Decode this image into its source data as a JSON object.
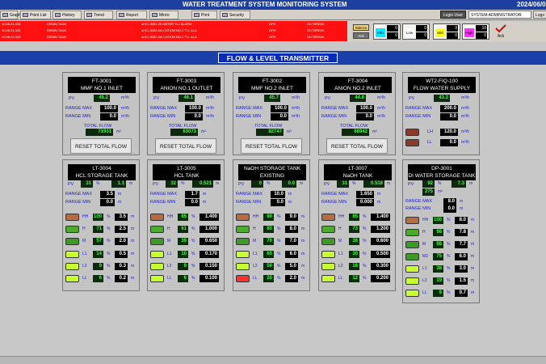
{
  "title": "WATER TREATMENT SYSTEM   MONITORING SYSTEM",
  "date": "2024/06/0",
  "toolbar": {
    "buttons": [
      {
        "label": "Graphics",
        "icon": "graphics-icon"
      },
      {
        "label": "Point List",
        "icon": "list-icon"
      },
      {
        "label": "History",
        "icon": "history-icon"
      },
      {
        "label": "Trend",
        "icon": "trend-icon"
      },
      {
        "label": "Report",
        "icon": "report-icon"
      },
      {
        "label": "Mimic",
        "icon": "mimic-icon"
      },
      {
        "label": "Print",
        "icon": "print-icon"
      },
      {
        "label": "Security",
        "icon": "security-icon"
      }
    ],
    "login_label": "Login User",
    "user": "SYSTEM ADMINISTRATOR",
    "logout_label": "Logo"
  },
  "alarms": [
    {
      "time": "10:06:21:333",
      "area": "DEMIN TANK",
      "desc": "aHIC-3003 26 WATER TLL ALARM",
      "state": "OFH",
      "status": "OUTBREAK"
    },
    {
      "time": "10:06:21:333",
      "area": "DEMIN TANK",
      "desc": "aHIC-3003 ##I CATION NO.1 TLL ALA",
      "state": "OFH",
      "status": "OUTBREAK"
    },
    {
      "time": "10:06:21:333",
      "area": "DEMIN TANK",
      "desc": "aHIC-3003 ##I CATION NO.1 TLL ALA",
      "state": "OFH",
      "status": "OUTBREAK"
    }
  ],
  "alarm_controls": {
    "silence": "Silence",
    "ack": "Ack"
  },
  "counters": [
    {
      "label": "Info",
      "v1": "0",
      "v2": "0",
      "color": "#00e8ff"
    },
    {
      "label": "Low",
      "v1": "0",
      "v2": "0",
      "color": "#ffffff"
    },
    {
      "label": "Mid",
      "v1": "3",
      "v2": "0",
      "color": "#ffff20"
    },
    {
      "label": "High",
      "v1": "10",
      "v2": "0",
      "color": "#ff30ff"
    }
  ],
  "ack_all_label": "Ack",
  "page_title": "FLOW & LEVEL TRANSMITTER",
  "flow_cards": [
    {
      "tag": "FT-3001",
      "name": "MMF NO.1  INLET",
      "pv": "45.2",
      "range_max": "100.0",
      "range_min": "0.0",
      "total": "71931"
    },
    {
      "tag": "FT-3003",
      "name": "ANION  NO.1 OUTLET",
      "pv": "46.1",
      "range_max": "100.0",
      "range_min": "0.0",
      "total": "63073"
    },
    {
      "tag": "FT-3002",
      "name": "MMF NO.2  INLET",
      "pv": "45.7",
      "range_max": "100.0",
      "range_min": "0.0",
      "total": "82747"
    },
    {
      "tag": "FT-3004",
      "name": "ANION  NO.2  INLET",
      "pv": "44.8",
      "range_max": "100.0",
      "range_min": "0.0",
      "total": "68942"
    }
  ],
  "wt2": {
    "tag": "WT2-FIQ-100",
    "name": "FLOW WATER SUPPLY",
    "pv": "43.2",
    "range_max": "200.0",
    "range_min": "0.0",
    "lh": "120.0",
    "ll": "0.0"
  },
  "labels": {
    "pv": "PV",
    "range_max": "RANGE MAX",
    "range_min": "RANGE MIN",
    "total_flow": "TOTAL FLOW",
    "reset": "RESET TOTAL FLOW",
    "flow_unit": "m³/h",
    "vol_unit": "m³",
    "pct": "%",
    "m": "m",
    "lh": "LH",
    "ll": "LL"
  },
  "level_cards": [
    {
      "tag": "LT-3004",
      "name": "HCL STORAGE TANK",
      "pv_pct": "31",
      "pv_m": "1.1",
      "range_max": "3.5",
      "range_min": "0.0",
      "alarms": [
        {
          "l": "HH",
          "p": "100",
          "v": "3.5"
        },
        {
          "l": "H",
          "p": "71",
          "v": "2.5"
        },
        {
          "l": "M",
          "p": "57",
          "v": "2.0"
        },
        {
          "l": "L1",
          "p": "14",
          "v": "0.5"
        },
        {
          "l": "L2",
          "p": "9",
          "v": "0.3"
        },
        {
          "l": "LL",
          "p": "6",
          "v": "0.2"
        }
      ]
    },
    {
      "tag": "LT-3005",
      "name": "HCL TANK",
      "pv_pct": "32",
      "pv_m": "0.521",
      "range_max": "1.7",
      "range_min": "0.0",
      "alarms": [
        {
          "l": "HH",
          "p": "85",
          "v": "1.400"
        },
        {
          "l": "H",
          "p": "61",
          "v": "1.000"
        },
        {
          "l": "M",
          "p": "39",
          "v": "0.650"
        },
        {
          "l": "L1",
          "p": "10",
          "v": "0.170"
        },
        {
          "l": "L2",
          "p": "9",
          "v": "0.150"
        },
        {
          "l": "LL",
          "p": "6",
          "v": "0.100"
        }
      ]
    },
    {
      "tag": "NaOH STORAGE TANK",
      "name": "EXISTING",
      "pv_pct": "0",
      "pv_m": "0.0",
      "range_max": "10.0",
      "range_min": "0.0",
      "alarms": [
        {
          "l": "HH",
          "p": "90",
          "v": "9.0"
        },
        {
          "l": "H",
          "p": "80",
          "v": "8.0"
        },
        {
          "l": "M",
          "p": "70",
          "v": "7.0"
        },
        {
          "l": "L1",
          "p": "60",
          "v": "6.0"
        },
        {
          "l": "L2",
          "p": "50",
          "v": "5.0"
        },
        {
          "l": "LL",
          "p": "20",
          "v": "2.0"
        }
      ]
    },
    {
      "tag": "LT-3007",
      "name": "NaOH TANK",
      "pv_pct": "31",
      "pv_m": "0.518",
      "range_max": "1.650",
      "range_min": "0.000",
      "alarms": [
        {
          "l": "HH",
          "p": "85",
          "v": "1.400"
        },
        {
          "l": "H",
          "p": "73",
          "v": "1.200"
        },
        {
          "l": "M",
          "p": "36",
          "v": "0.600"
        },
        {
          "l": "L1",
          "p": "30",
          "v": "0.500"
        },
        {
          "l": "L2",
          "p": "18",
          "v": "0.300"
        },
        {
          "l": "LL",
          "p": "12",
          "v": "0.200"
        }
      ]
    },
    {
      "tag": "DP-3001",
      "name": "DI WATER STORAGE TANK",
      "pv_pct": "92",
      "pv_m": "7.3",
      "pv_m3": "275",
      "range_max": "8.0",
      "range_min": "0.0",
      "alarms": [
        {
          "l": "HH",
          "p": "100",
          "v": "8.0"
        },
        {
          "l": "H",
          "p": "98",
          "v": "7.8"
        },
        {
          "l": "M",
          "p": "98",
          "v": "7.7"
        },
        {
          "l": "M2",
          "p": "75",
          "v": "6.0"
        },
        {
          "l": "L1",
          "p": "38",
          "v": "3.0"
        },
        {
          "l": "L2",
          "p": "19",
          "v": "1.5"
        },
        {
          "l": "LL",
          "p": "9",
          "v": "0.7"
        }
      ]
    }
  ],
  "colors": {
    "lamp_hh": "#b86a40",
    "lamp_h": "#4caa2a",
    "lamp_m": "#3e9a26",
    "lamp_low_on": "#c8ff30",
    "lamp_ll_alarm": "#ff3030",
    "lamp_wt2": "#8a3a2a"
  }
}
